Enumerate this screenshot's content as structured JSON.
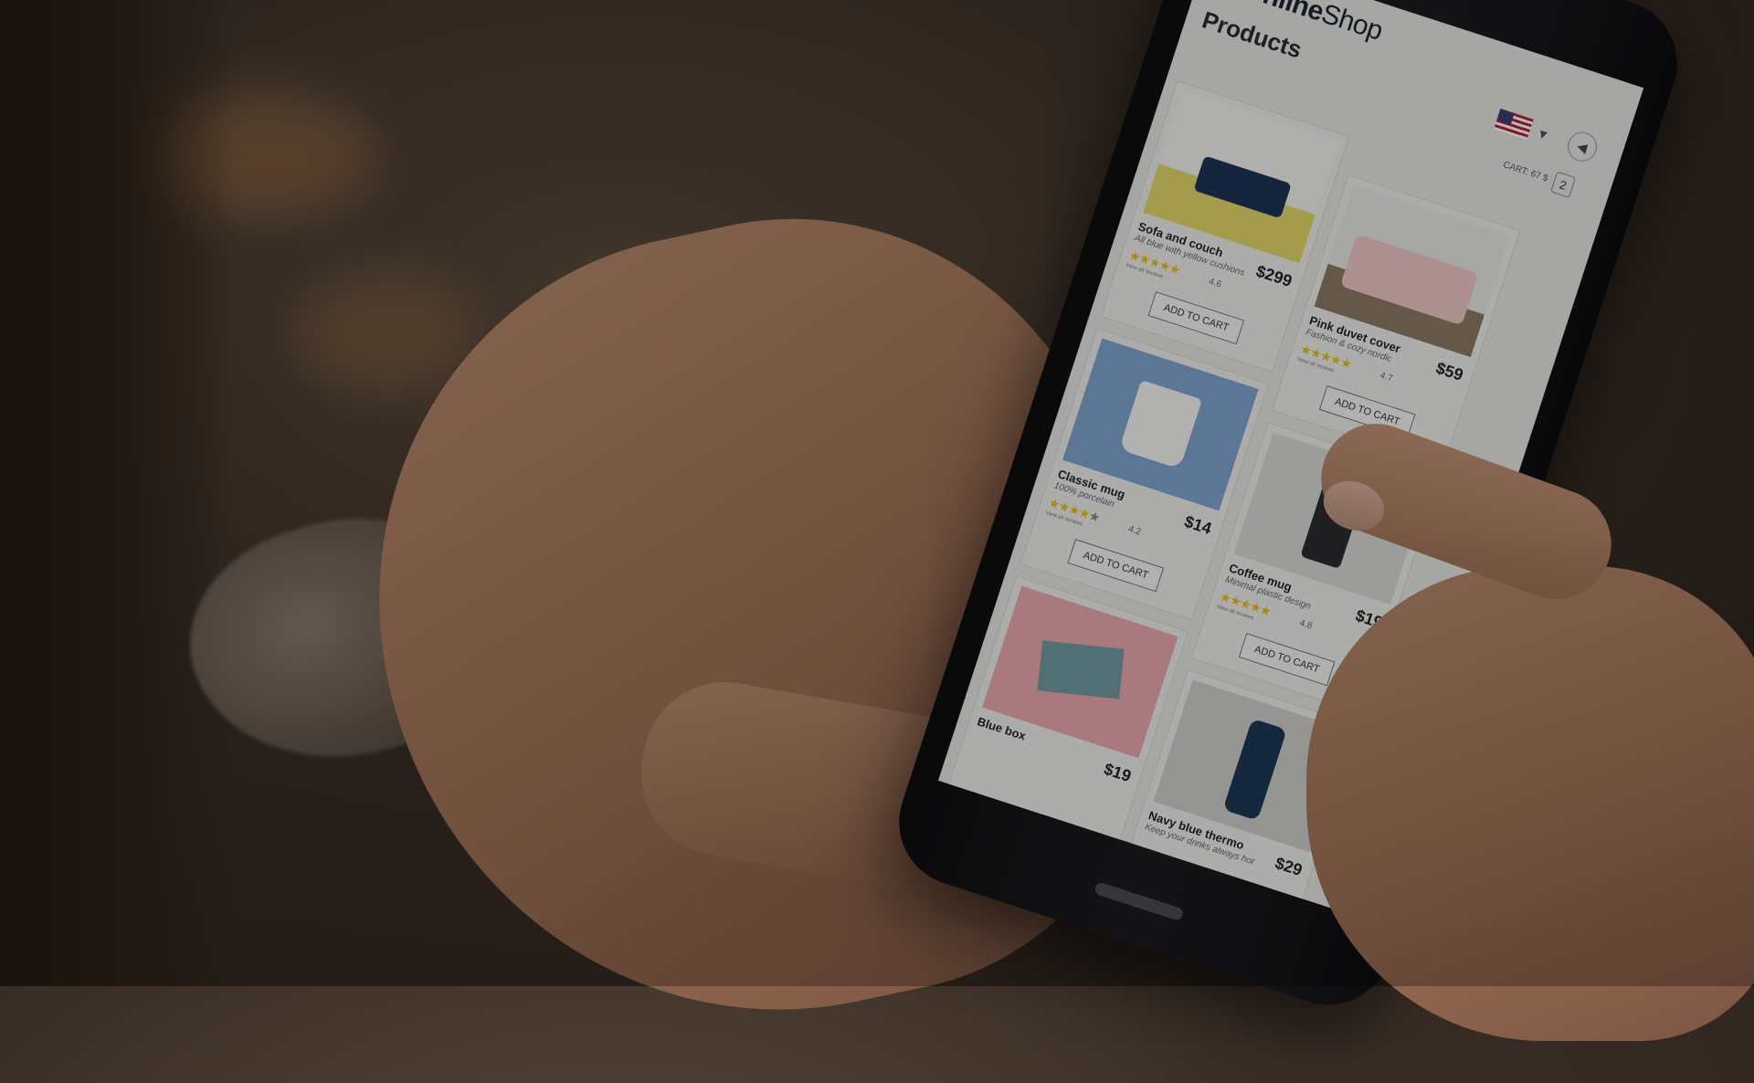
{
  "app": {
    "brand_bold": "Online",
    "brand_light": "Shop",
    "page_title": "Products",
    "cart_label": "CART: 67 $",
    "cart_count": "2"
  },
  "products": [
    {
      "name": "Sofa and couch",
      "desc": "All blue with yellow cushions",
      "price": "$299",
      "rating": "4.6",
      "reviews": "View all reviews",
      "add": "ADD TO CART"
    },
    {
      "name": "Pink duvet cover",
      "desc": "Fashion & cozy nordic",
      "price": "$59",
      "rating": "4.7",
      "reviews": "View all reviews",
      "add": "ADD TO CART"
    },
    {
      "name": "Classic mug",
      "desc": "100% porcelain",
      "price": "$14",
      "rating": "4.2",
      "reviews": "View all reviews",
      "add": "ADD TO CART"
    },
    {
      "name": "Coffee mug",
      "desc": "Minimal plastic design",
      "price": "$19",
      "rating": "4.8",
      "reviews": "View all reviews",
      "add": "ADD TO CART"
    },
    {
      "name": "Blue box",
      "desc": "",
      "price": "$19",
      "rating": "",
      "reviews": "",
      "add": ""
    },
    {
      "name": "Navy blue thermo",
      "desc": "Keep your drinks always hot",
      "price": "$29",
      "rating": "",
      "reviews": "",
      "add": ""
    }
  ],
  "colors": {
    "star": "#e7c21b",
    "brand_blue": "#4f7fb0"
  }
}
